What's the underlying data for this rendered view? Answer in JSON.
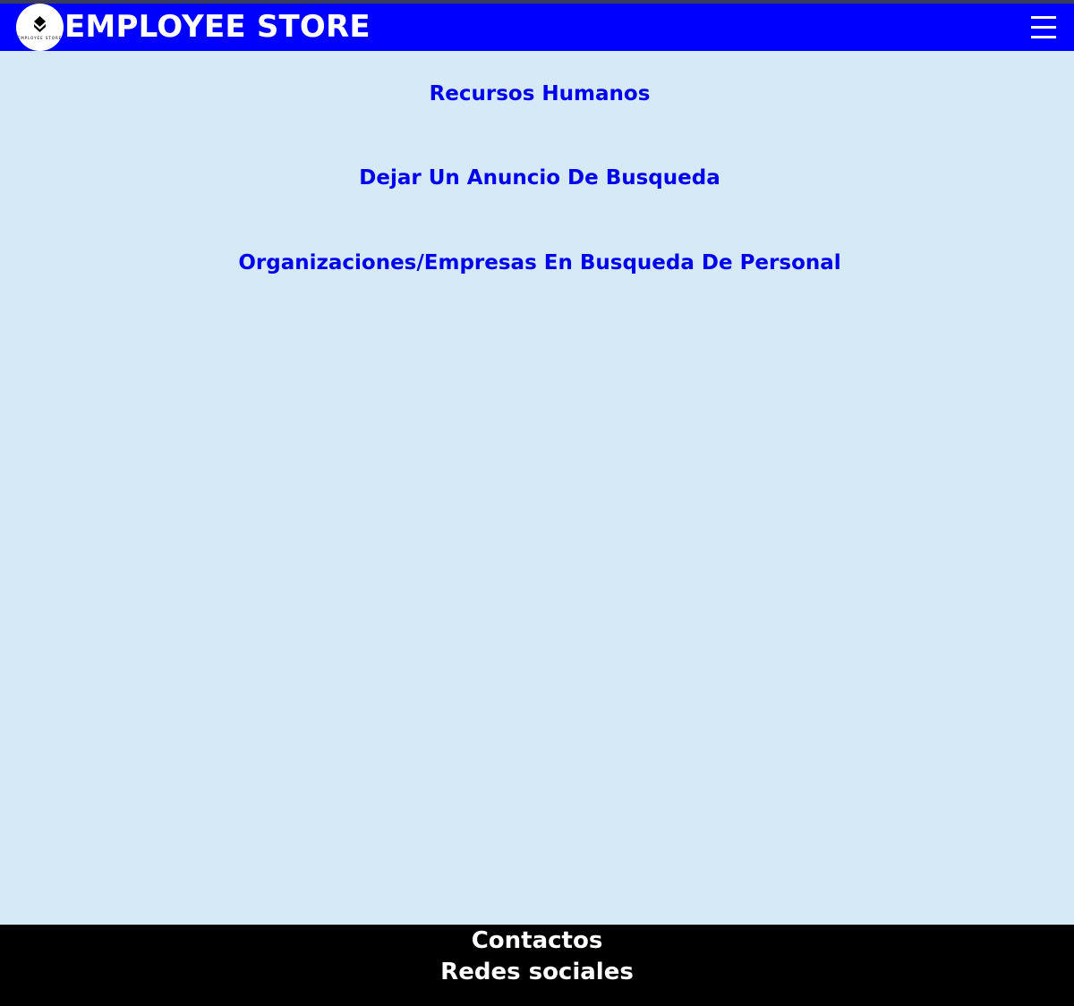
{
  "header": {
    "brand": "EMPLOYEE STORE",
    "logo_text": "EMPLOYEE STORE",
    "menu_icon": "hamburger-icon",
    "background_color": "#0000ff"
  },
  "main": {
    "background_color": "#d6e9f7",
    "links": [
      {
        "label": "Recursos Humanos"
      },
      {
        "label": "Dejar Un Anuncio De Busqueda"
      },
      {
        "label": "Organizaciones/Empresas En Busqueda De Personal"
      }
    ],
    "link_color": "#0000ee"
  },
  "footer": {
    "contacts_label": "Contactos",
    "social_label": "Redes sociales",
    "background_color": "#000000"
  }
}
